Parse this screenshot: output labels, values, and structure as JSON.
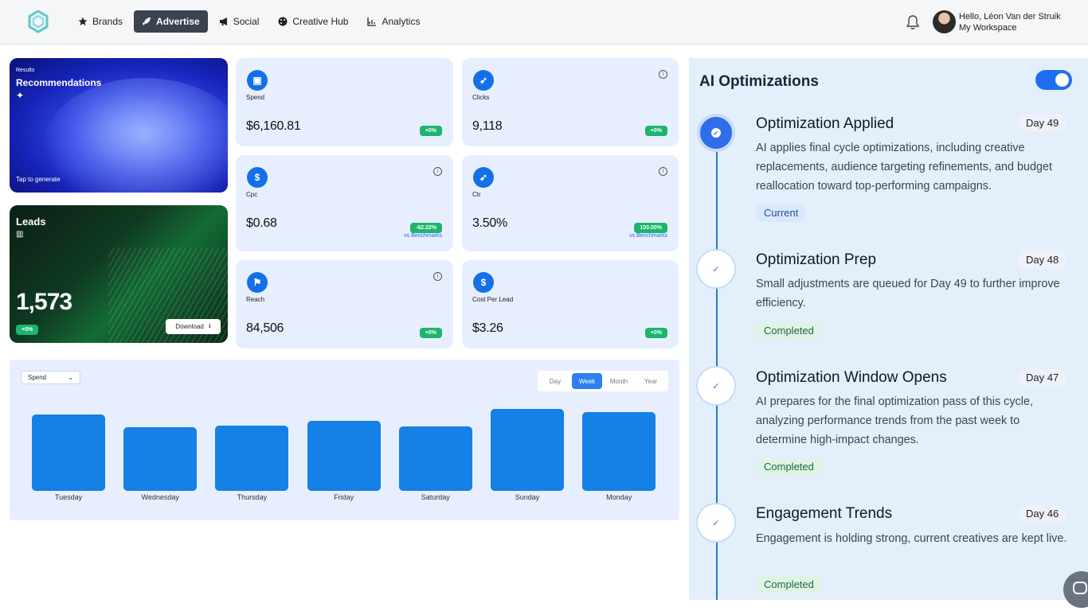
{
  "user": {
    "greeting": "Hello, Léon Van der Struik",
    "workspace": "My Workspace"
  },
  "nav": [
    {
      "label": "Brands",
      "icon": "star-icon"
    },
    {
      "label": "Advertise",
      "icon": "rocket-icon",
      "active": true
    },
    {
      "label": "Social",
      "icon": "megaphone-icon"
    },
    {
      "label": "Creative Hub",
      "icon": "palette-icon"
    },
    {
      "label": "Analytics",
      "icon": "chart-icon"
    }
  ],
  "recommendations": {
    "small": "Results",
    "title": "Recommendations",
    "tap": "Tap to generate"
  },
  "leads": {
    "title": "Leads",
    "value": "1,573",
    "badge": "+0%",
    "download": "Download"
  },
  "metrics": {
    "spend": {
      "label": "Spend",
      "value": "$6,160.81",
      "badge": "+0%"
    },
    "clicks": {
      "label": "Clicks",
      "value": "9,118",
      "badge": "+0%"
    },
    "cpc": {
      "label": "Cpc",
      "value": "$0.68",
      "badge": "-62.22%",
      "bench": "vs Benchmarks"
    },
    "ctr": {
      "label": "Ctr",
      "value": "3.50%",
      "badge": "100.00%",
      "bench": "vs Benchmarks"
    },
    "reach": {
      "label": "Reach",
      "value": "84,506",
      "badge": "+0%"
    },
    "cpl": {
      "label": "Cost Per Lead",
      "value": "$3.26",
      "badge": "+0%"
    }
  },
  "chart_controls": {
    "select": "Spend",
    "ranges": [
      "Day",
      "Week",
      "Month",
      "Year"
    ],
    "active_range": "Week"
  },
  "chart_data": {
    "type": "bar",
    "categories": [
      "Tuesday",
      "Wednesday",
      "Thursday",
      "Friday",
      "Saturday",
      "Sunday",
      "Monday"
    ],
    "values": [
      96,
      80,
      82,
      88,
      81,
      103,
      99
    ],
    "ylim": [
      0,
      110
    ]
  },
  "ai": {
    "title": "AI Optimizations",
    "toggle_on": true,
    "steps": [
      {
        "title": "Optimization Applied",
        "day": "Day 49",
        "desc": "AI applies final cycle optimizations, including creative replacements, audience targeting refinements, and budget reallocation toward top-performing campaigns.",
        "status": "Current"
      },
      {
        "title": "Optimization Prep",
        "day": "Day 48",
        "desc": "Small adjustments are queued for Day 49 to further improve efficiency.",
        "status": "Completed"
      },
      {
        "title": "Optimization Window Opens",
        "day": "Day 47",
        "desc": "AI prepares for the final optimization pass of this cycle, analyzing performance trends from the past week to determine high-impact changes.",
        "status": "Completed"
      },
      {
        "title": "Engagement Trends",
        "day": "Day 46",
        "desc": "Engagement is holding strong, current creatives are kept live.",
        "status": "Completed"
      }
    ]
  },
  "colors": {
    "accent": "#1580e6",
    "success": "#1db56e",
    "nav_active": "#3b4251"
  }
}
